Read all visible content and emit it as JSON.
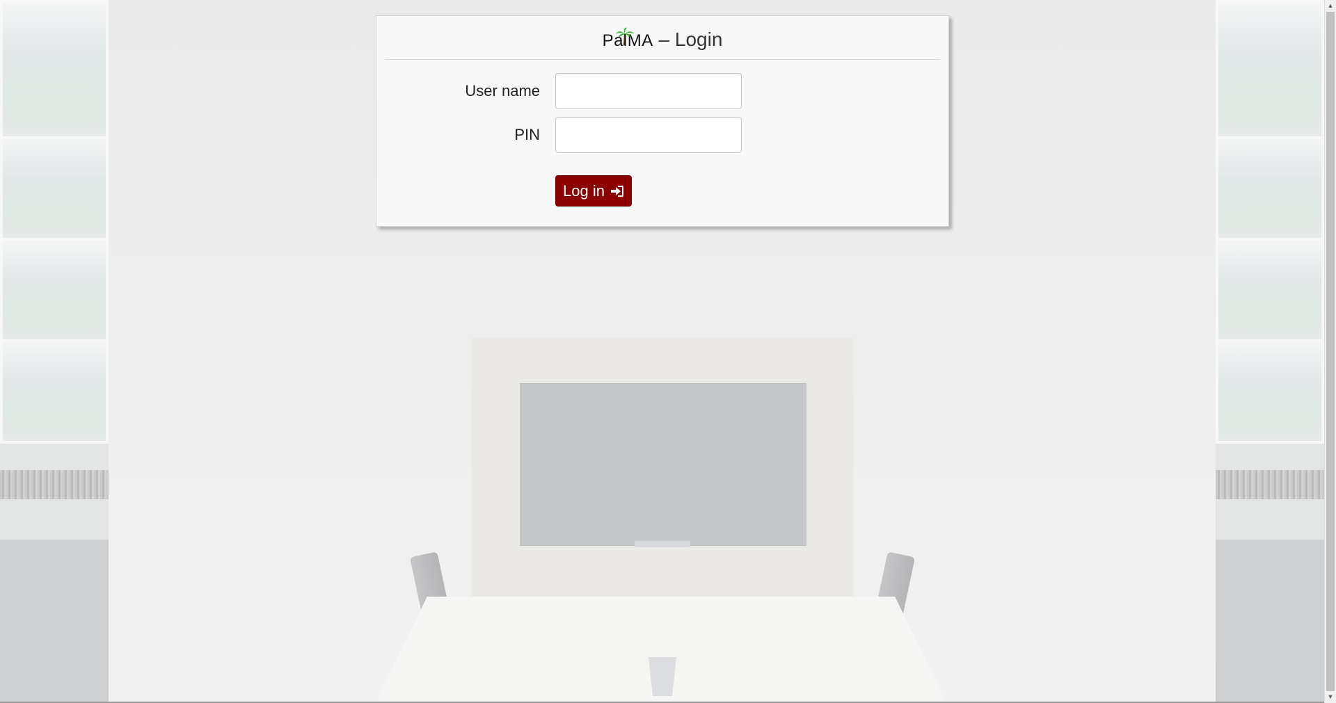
{
  "page": {
    "title_logo_text": "PalMA",
    "title_suffix": " – Login"
  },
  "form": {
    "username_label": "User name",
    "username_value": "",
    "pin_label": "PIN",
    "pin_value": "",
    "submit_label": "Log in",
    "submit_icon": "sign-in-icon"
  },
  "colors": {
    "accent": "#8b0000",
    "palm_green": "#2ec21e"
  }
}
